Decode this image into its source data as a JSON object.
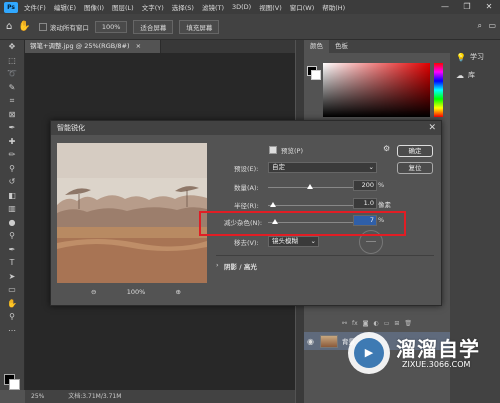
{
  "menubar": {
    "logo": "Ps",
    "items": [
      "文件(F)",
      "编辑(E)",
      "图像(I)",
      "图层(L)",
      "文字(Y)",
      "选择(S)",
      "滤镜(T)",
      "3D(D)",
      "视图(V)",
      "窗口(W)",
      "帮助(H)"
    ],
    "window_controls": [
      "—",
      "❐",
      "✕"
    ]
  },
  "options": {
    "scroll_all": "滚动所有窗口",
    "zoom_btn": "100%",
    "fit_screen": "适合屏幕",
    "fill_screen": "填充屏幕"
  },
  "document": {
    "tab_label": "钢笔+调整.jpg @ 25%(RGB/8#)",
    "tab_close": "×",
    "zoom": "25%",
    "doc_info": "文档:3.71M/3.71M"
  },
  "panels": {
    "tab_color": "颜色",
    "tab_swatches": "色板",
    "learn": "学习",
    "library": "库",
    "layer_name": "背景"
  },
  "dialog": {
    "title": "智能锐化",
    "close": "✕",
    "preview_label": "预览(P)",
    "ok": "确定",
    "reset": "复位",
    "preset_label": "预设(E):",
    "preset_value": "自定",
    "amount_label": "数量(A):",
    "amount_value": "200",
    "amount_unit": "%",
    "amount_fraction": 0.4,
    "radius_label": "半径(R):",
    "radius_value": "1.0",
    "radius_unit": "像素",
    "radius_fraction": 0.05,
    "noise_label": "减少杂色(N):",
    "noise_value": "7",
    "noise_unit": "%",
    "noise_fraction": 0.07,
    "remove_label": "移去(V):",
    "remove_value": "镜头模糊",
    "shadows_label": "阴影 / 高光",
    "zoom_out": "⊖",
    "zoom_level": "100%",
    "zoom_in": "⊕"
  },
  "watermark": {
    "title": "溜溜自学",
    "url": "ZIXUE.3066.COM",
    "logo_glyph": "▶"
  },
  "colors": {
    "highlight": "#e11d24",
    "brand": "#3e7ab3"
  }
}
